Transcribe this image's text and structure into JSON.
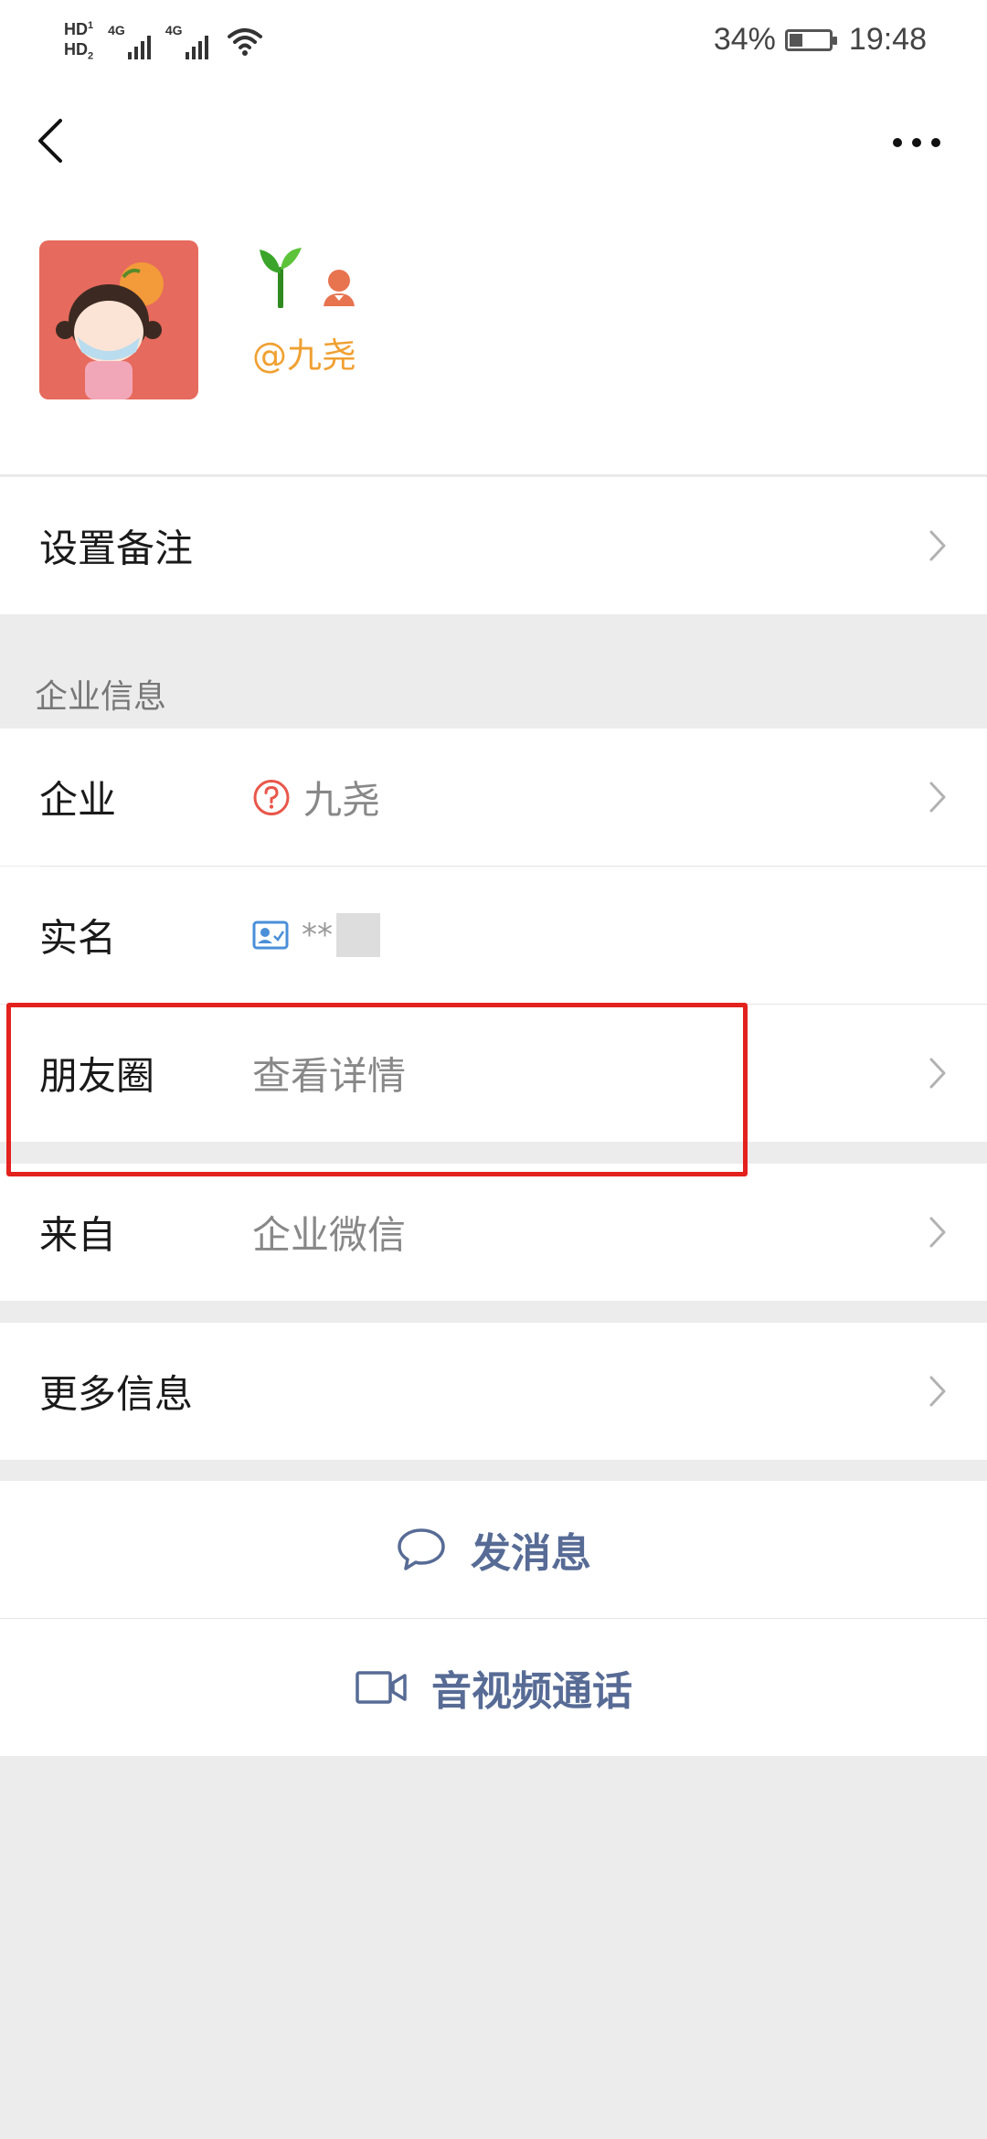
{
  "status_bar": {
    "hd1": "HD",
    "hd1_sub": "1",
    "hd2": "HD",
    "hd2_sub": "2",
    "net1": "4G",
    "net2": "4G",
    "battery_percent": "34%",
    "time": "19:48"
  },
  "header": {
    "back_icon": "chevron-left-icon",
    "more_icon": "more-horizontal-icon",
    "handle": "@九尧"
  },
  "rows": {
    "set_remark": "设置备注",
    "enterprise_section_title": "企业信息",
    "enterprise_label": "企业",
    "enterprise_value": "九尧",
    "realname_label": "实名",
    "realname_value": "**",
    "moments_label": "朋友圈",
    "moments_value": "查看详情",
    "from_label": "来自",
    "from_value": "企业微信",
    "more_info": "更多信息"
  },
  "actions": {
    "send_message": "发消息",
    "video_call": "音视频通话"
  },
  "colors": {
    "accent_blue": "#576b95",
    "handle_orange": "#f0a032",
    "highlight_red": "#e3221e",
    "background": "#ececec"
  }
}
